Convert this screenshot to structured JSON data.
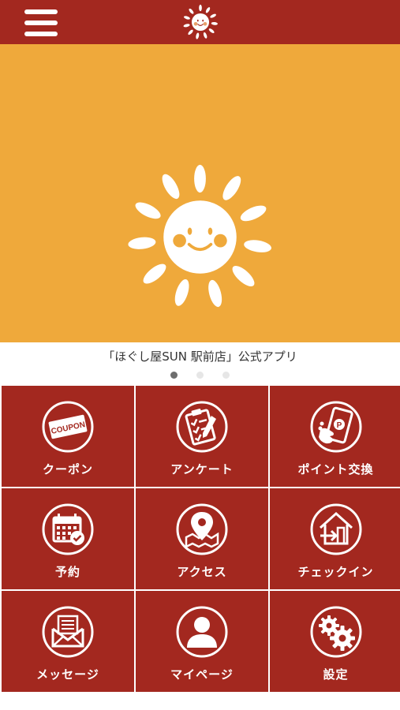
{
  "app": {
    "caption": "「ほぐし屋SUN 駅前店」公式アプリ",
    "header_logo_icon": "sun-face-icon",
    "menu_icon": "hamburger-menu-icon"
  },
  "carousel": {
    "slide_count": 3,
    "active_index": 0
  },
  "menu_tiles": [
    {
      "label": "クーポン",
      "icon": "coupon-icon"
    },
    {
      "label": "アンケート",
      "icon": "survey-clipboard-icon"
    },
    {
      "label": "ポイント交換",
      "icon": "point-exchange-phone-icon"
    },
    {
      "label": "予約",
      "icon": "calendar-reservation-icon"
    },
    {
      "label": "アクセス",
      "icon": "map-pin-icon"
    },
    {
      "label": "チェックイン",
      "icon": "check-in-door-icon"
    },
    {
      "label": "メッセージ",
      "icon": "message-envelope-icon"
    },
    {
      "label": "マイページ",
      "icon": "user-profile-icon"
    },
    {
      "label": "設定",
      "icon": "settings-gears-icon"
    }
  ],
  "colors": {
    "header": "#a3281f",
    "tile": "#a3281f",
    "banner": "#efa93b",
    "tile_text": "#ffffff",
    "dot_active": "#6e6e6e",
    "dot_inactive": "#e6e6e6"
  }
}
